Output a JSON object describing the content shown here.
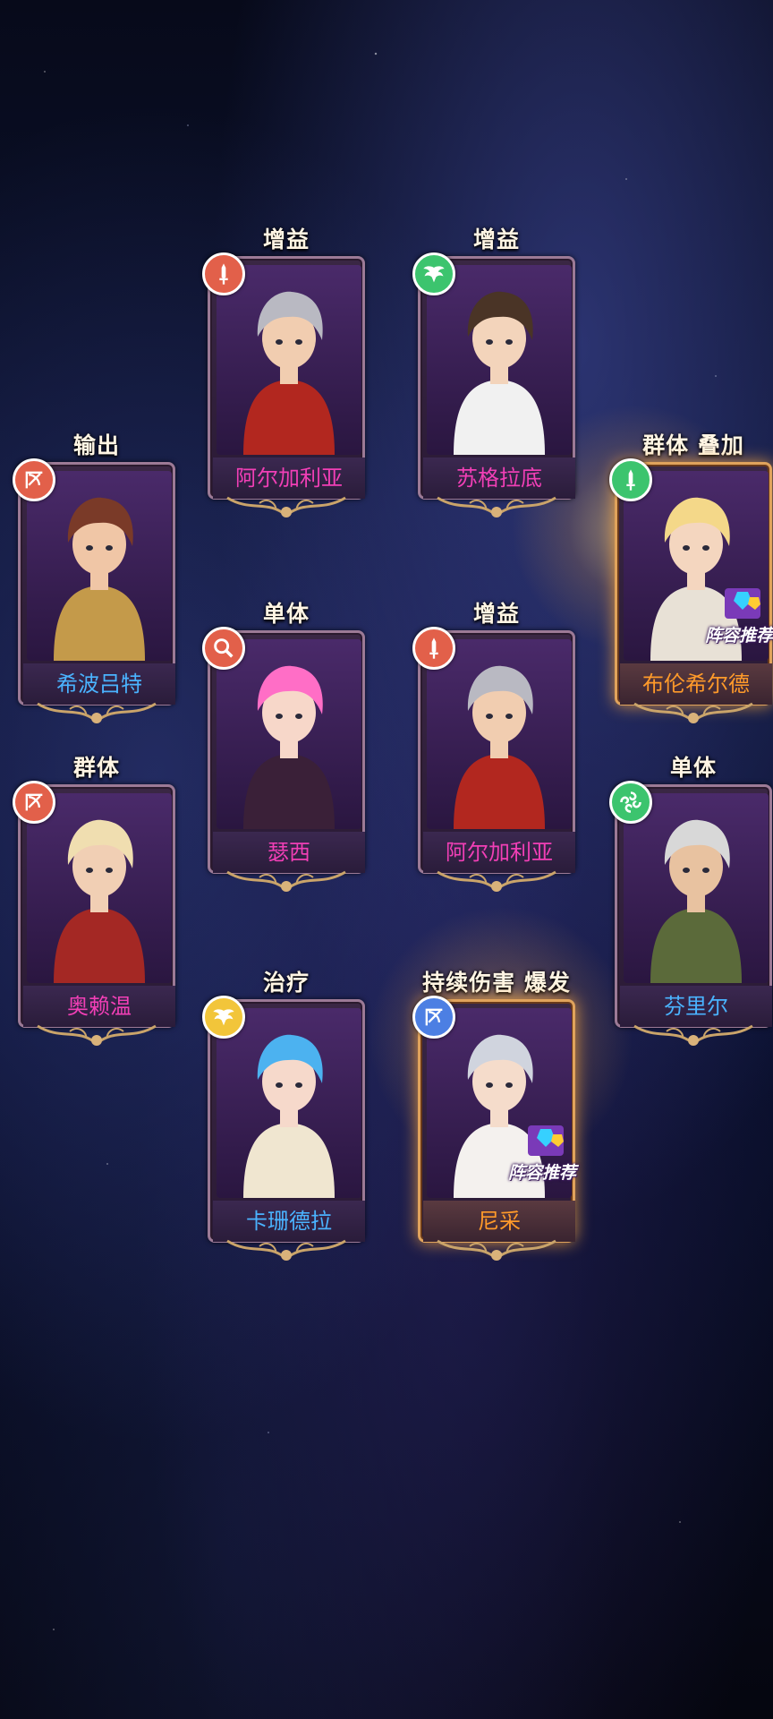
{
  "colors": {
    "name_pink": "#f13fb6",
    "name_blue": "#4ab3ff",
    "name_orange": "#ff9a2a",
    "icon_red": "#e2604a",
    "icon_green": "#3cc46e",
    "icon_blue": "#4c7fe3",
    "icon_yellow": "#f2c53a"
  },
  "cards": [
    {
      "id": "c1",
      "title": "增益",
      "name": "阿尔加利亚",
      "name_color": "name_pink",
      "icon": "sword-icon",
      "icon_color": "icon_red",
      "recommended": false
    },
    {
      "id": "c2",
      "title": "增益",
      "name": "苏格拉底",
      "name_color": "name_pink",
      "icon": "wings-icon",
      "icon_color": "icon_green",
      "recommended": false
    },
    {
      "id": "c3",
      "title": "输出",
      "name": "希波吕特",
      "name_color": "name_blue",
      "icon": "bow-icon",
      "icon_color": "icon_red",
      "recommended": false
    },
    {
      "id": "c4",
      "title": "群体 叠加",
      "name": "布伦希尔德",
      "name_color": "name_orange",
      "icon": "sword-icon",
      "icon_color": "icon_green",
      "recommended": true
    },
    {
      "id": "c5",
      "title": "单体",
      "name": "瑟西",
      "name_color": "name_pink",
      "icon": "magic-icon",
      "icon_color": "icon_red",
      "recommended": false
    },
    {
      "id": "c6",
      "title": "增益",
      "name": "阿尔加利亚",
      "name_color": "name_pink",
      "icon": "sword-icon",
      "icon_color": "icon_red",
      "recommended": false
    },
    {
      "id": "c7",
      "title": "群体",
      "name": "奥赖温",
      "name_color": "name_pink",
      "icon": "bow-icon",
      "icon_color": "icon_red",
      "recommended": false
    },
    {
      "id": "c8",
      "title": "单体",
      "name": "芬里尔",
      "name_color": "name_blue",
      "icon": "swirl-icon",
      "icon_color": "icon_green",
      "recommended": false
    },
    {
      "id": "c9",
      "title": "治疗",
      "name": "卡珊德拉",
      "name_color": "name_blue",
      "icon": "wings-icon",
      "icon_color": "icon_yellow",
      "recommended": false
    },
    {
      "id": "c10",
      "title": "持续伤害 爆发",
      "name": "尼采",
      "name_color": "name_orange",
      "icon": "bow-icon",
      "icon_color": "icon_blue",
      "recommended": true
    }
  ],
  "badge": {
    "recommended_label": "阵容推荐"
  }
}
